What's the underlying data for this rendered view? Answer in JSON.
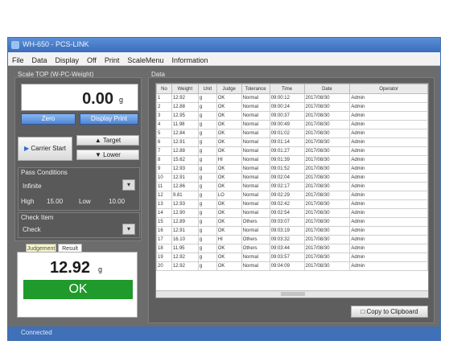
{
  "window": {
    "title": "WH-650 - PCS-LINK"
  },
  "menu": [
    "File",
    "Data",
    "Display",
    "Off",
    "Print",
    "ScaleMenu",
    "Information"
  ],
  "weigh_panel": {
    "header": "Scale TOP (W-PC-Weight)",
    "value": "0.00",
    "unit": "g",
    "zero_label": "Zero",
    "print_label": "Display Print",
    "carrier_label": "Carrier Start",
    "target_label": "Target",
    "lower_label": "Lower",
    "cond_header": "Pass Conditions",
    "cond_value": "Infinite",
    "high_label": "High",
    "high_value": "15.00",
    "low_label": "Low",
    "low_value": "10.00",
    "order_header": "Check Item",
    "order_value": "Check"
  },
  "result_panel": {
    "tab1": "Judgement",
    "tab2": "Result",
    "value": "12.92",
    "unit": "g",
    "status": "OK",
    "status_color": "#1f9a2b"
  },
  "data_panel": {
    "header": "Data",
    "columns": [
      "No",
      "Weight",
      "Unit",
      "Judge",
      "Tolerance",
      "Time",
      "Date",
      "Operator"
    ],
    "rows": [
      [
        "1",
        "12.92",
        "g",
        "OK",
        "Normal",
        "09:00:12",
        "2017/08/30",
        "Admin"
      ],
      [
        "2",
        "12.88",
        "g",
        "OK",
        "Normal",
        "09:00:24",
        "2017/08/30",
        "Admin"
      ],
      [
        "3",
        "12.95",
        "g",
        "OK",
        "Normal",
        "09:00:37",
        "2017/08/30",
        "Admin"
      ],
      [
        "4",
        "11.98",
        "g",
        "OK",
        "Normal",
        "09:00:49",
        "2017/08/30",
        "Admin"
      ],
      [
        "5",
        "12.84",
        "g",
        "OK",
        "Normal",
        "09:01:02",
        "2017/08/30",
        "Admin"
      ],
      [
        "6",
        "12.91",
        "g",
        "OK",
        "Normal",
        "09:01:14",
        "2017/08/30",
        "Admin"
      ],
      [
        "7",
        "12.88",
        "g",
        "OK",
        "Normal",
        "09:01:27",
        "2017/08/30",
        "Admin"
      ],
      [
        "8",
        "15.62",
        "g",
        "HI",
        "Normal",
        "09:01:39",
        "2017/08/30",
        "Admin"
      ],
      [
        "9",
        "12.93",
        "g",
        "OK",
        "Normal",
        "09:01:52",
        "2017/08/30",
        "Admin"
      ],
      [
        "10",
        "12.91",
        "g",
        "OK",
        "Normal",
        "09:02:04",
        "2017/08/30",
        "Admin"
      ],
      [
        "11",
        "12.86",
        "g",
        "OK",
        "Normal",
        "09:02:17",
        "2017/08/30",
        "Admin"
      ],
      [
        "12",
        "9.81",
        "g",
        "LO",
        "Normal",
        "09:02:29",
        "2017/08/30",
        "Admin"
      ],
      [
        "13",
        "12.93",
        "g",
        "OK",
        "Normal",
        "09:02:42",
        "2017/08/30",
        "Admin"
      ],
      [
        "14",
        "12.90",
        "g",
        "OK",
        "Normal",
        "09:02:54",
        "2017/08/30",
        "Admin"
      ],
      [
        "15",
        "12.89",
        "g",
        "OK",
        "Others",
        "09:03:07",
        "2017/08/30",
        "Admin"
      ],
      [
        "16",
        "12.91",
        "g",
        "OK",
        "Normal",
        "09:03:19",
        "2017/08/30",
        "Admin"
      ],
      [
        "17",
        "16.10",
        "g",
        "HI",
        "Others",
        "09:03:32",
        "2017/08/30",
        "Admin"
      ],
      [
        "18",
        "11.95",
        "g",
        "OK",
        "Others",
        "09:03:44",
        "2017/08/30",
        "Admin"
      ],
      [
        "19",
        "12.92",
        "g",
        "OK",
        "Normal",
        "09:03:57",
        "2017/08/30",
        "Admin"
      ],
      [
        "20",
        "12.92",
        "g",
        "OK",
        "Normal",
        "09:04:09",
        "2017/08/30",
        "Admin"
      ]
    ],
    "clipboard_label": "Copy to Clipboard"
  },
  "status_bar": {
    "text": "Connected"
  }
}
